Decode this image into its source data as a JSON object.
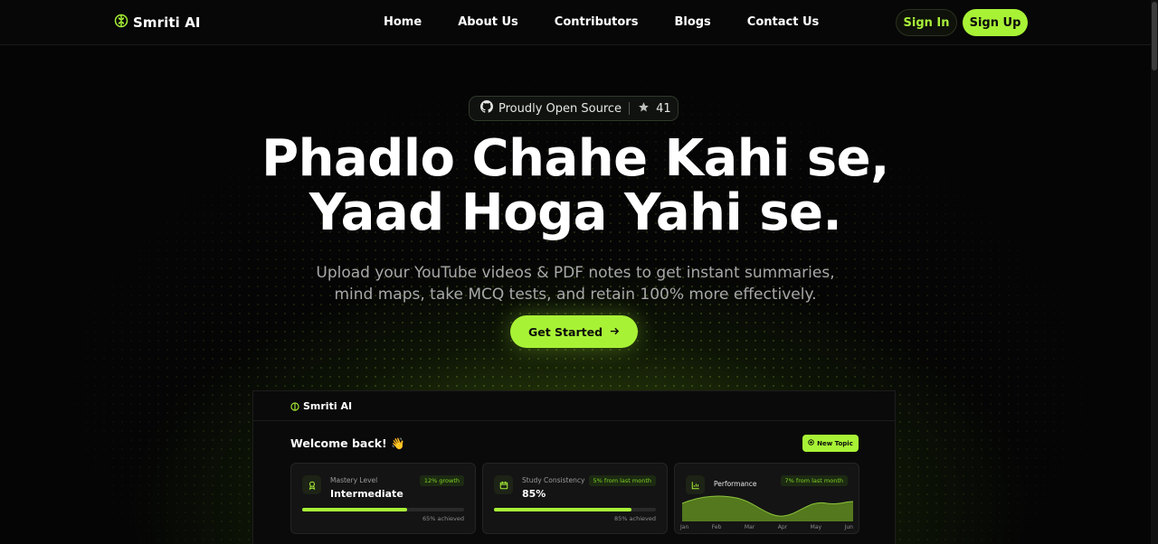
{
  "app": {
    "name": "Smriti AI"
  },
  "nav": {
    "links": [
      "Home",
      "About Us",
      "Contributors",
      "Blogs",
      "Contact Us"
    ],
    "sign_in": "Sign In",
    "sign_up": "Sign Up"
  },
  "hero": {
    "badge_text": "Proudly Open Source",
    "star_count": "41",
    "headline_line1": "Phadlo Chahe Kahi se,",
    "headline_line2": "Yaad Hoga Yahi se.",
    "subtitle_line1": "Upload your YouTube videos & PDF notes to get instant summaries,",
    "subtitle_line2": "mind maps, take MCQ tests, and retain 100% more effectively.",
    "cta": "Get Started"
  },
  "dashboard": {
    "brand": "Smriti AI",
    "welcome": "Welcome back! 👋",
    "new_topic": "New Topic",
    "cards": [
      {
        "label": "Mastery Level",
        "value": "Intermediate",
        "chip": "12% growth",
        "progress": 0.65,
        "achieved": "65% achieved"
      },
      {
        "label": "Study Consistency",
        "value": "85%",
        "chip": "5% from last month",
        "progress": 0.85,
        "achieved": "85% achieved"
      }
    ],
    "performance": {
      "label": "Performance",
      "chip": "7% from last month",
      "months": [
        "Jan",
        "Feb",
        "Mar",
        "Apr",
        "May",
        "Jun"
      ]
    }
  },
  "colors": {
    "accent": "#a8f236",
    "background": "#050505"
  }
}
